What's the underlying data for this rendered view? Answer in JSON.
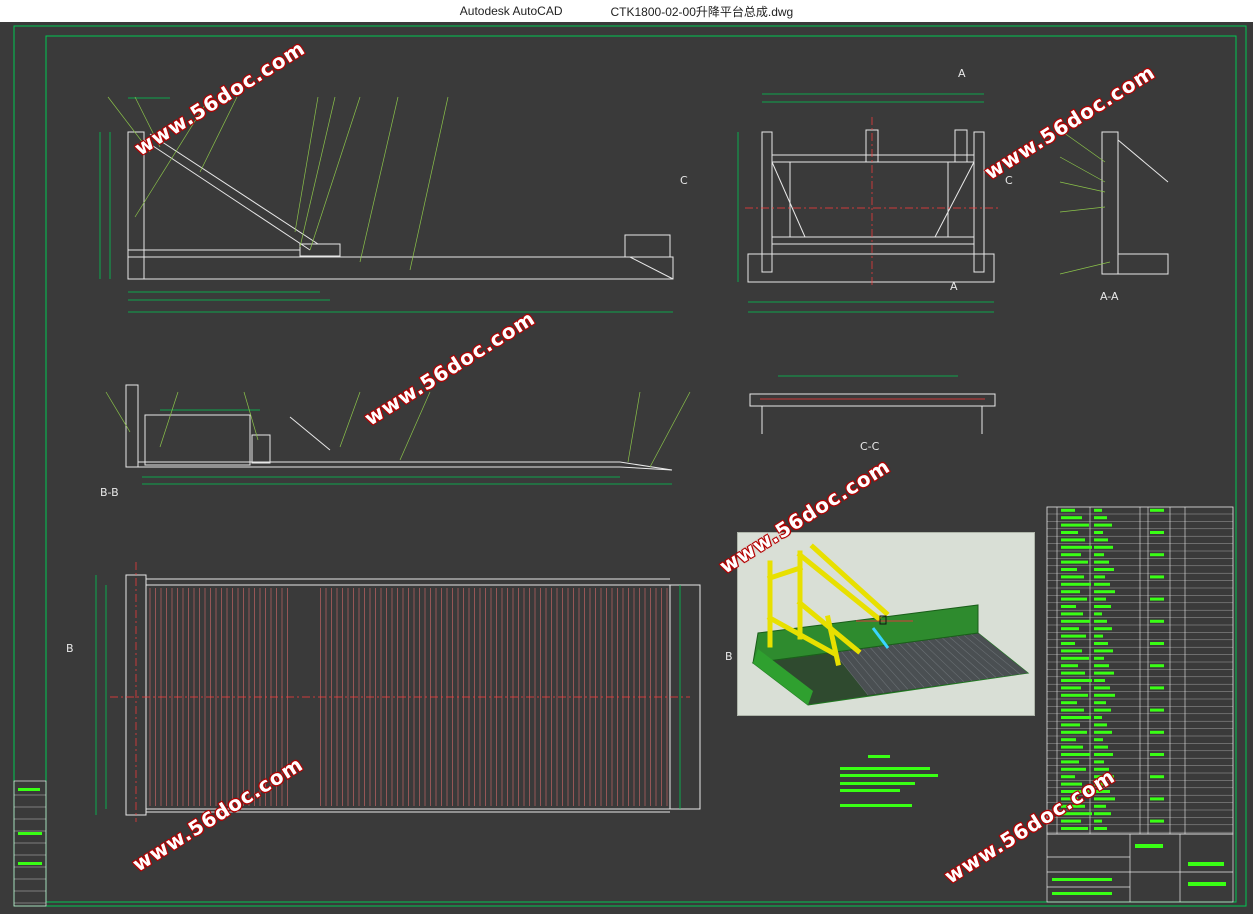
{
  "window": {
    "app_title": "Autodesk AutoCAD",
    "file_title": "CTK1800-02-00升降平台总成.dwg"
  },
  "views": {
    "section_aa": "A-A",
    "section_bb": "B-B",
    "section_cc": "C-C",
    "marker_a": "A",
    "marker_b": "B",
    "marker_c": "C"
  },
  "watermark": {
    "text": "www.56doc.com"
  },
  "colors": {
    "background": "#3a3a3a",
    "frame": "#00c853",
    "outline": "#e8e8e8",
    "dimension": "#00c853",
    "leader": "#8bc34a",
    "section": "#ff3b3b",
    "table_text": "#39ff14",
    "watermark_text": "#ffffff",
    "watermark_outline": "#b40000"
  }
}
